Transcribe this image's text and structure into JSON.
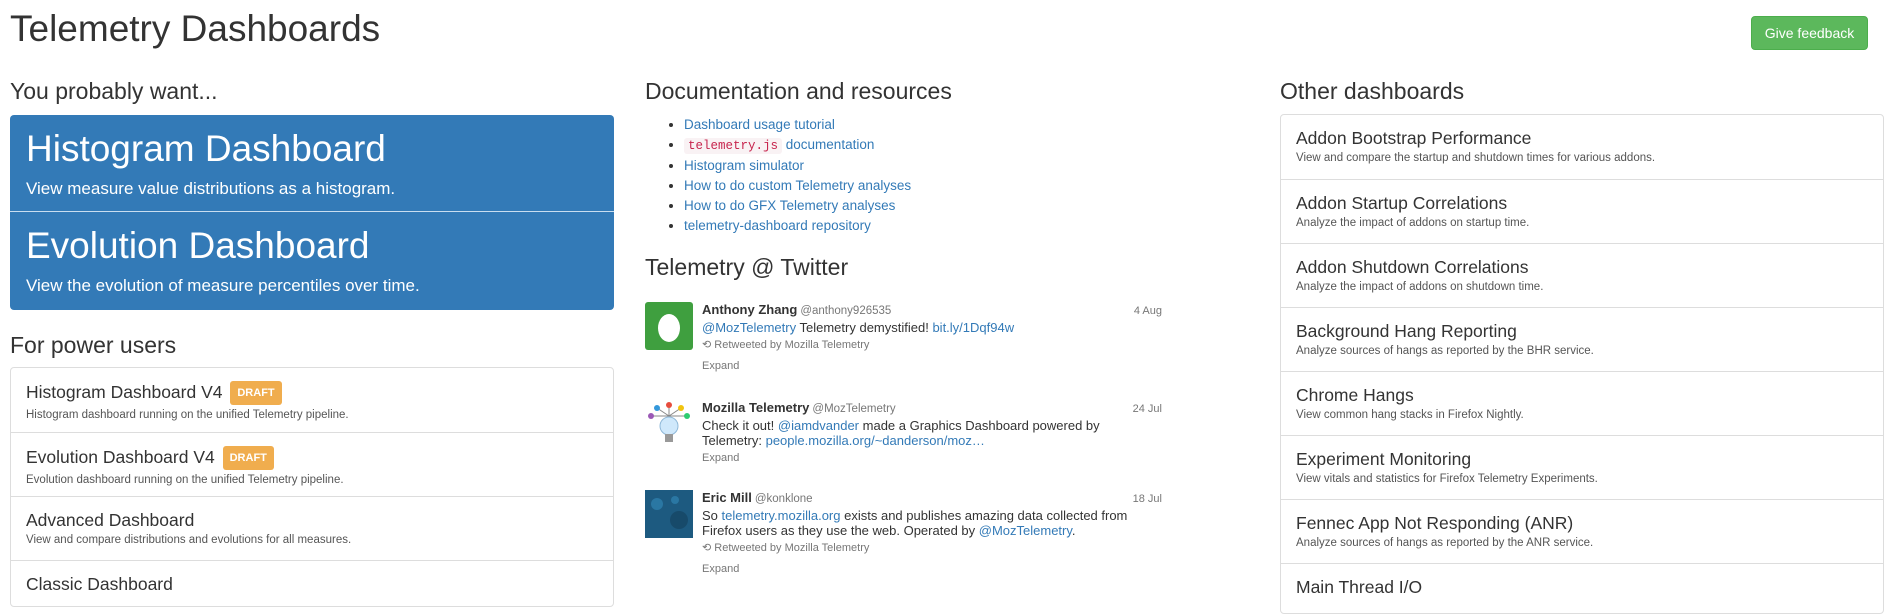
{
  "header": {
    "title": "Telemetry Dashboards",
    "feedback_label": "Give feedback"
  },
  "col1": {
    "want_title": "You probably want...",
    "primary": [
      {
        "title": "Histogram Dashboard",
        "subtitle": "View measure value distributions as a histogram."
      },
      {
        "title": "Evolution Dashboard",
        "subtitle": "View the evolution of measure percentiles over time."
      }
    ],
    "power_title": "For power users",
    "power_items": [
      {
        "title": "Histogram Dashboard V4",
        "badge": "DRAFT",
        "subtitle": "Histogram dashboard running on the unified Telemetry pipeline."
      },
      {
        "title": "Evolution Dashboard V4",
        "badge": "DRAFT",
        "subtitle": "Evolution dashboard running on the unified Telemetry pipeline."
      },
      {
        "title": "Advanced Dashboard",
        "subtitle": "View and compare distributions and evolutions for all measures."
      },
      {
        "title": "Classic Dashboard",
        "subtitle": ""
      }
    ]
  },
  "col2": {
    "docs_title": "Documentation and resources",
    "docs": [
      "Dashboard usage tutorial",
      {
        "code": "telemetry.js",
        "text": "documentation"
      },
      "Histogram simulator",
      "How to do custom Telemetry analyses",
      "How to do GFX Telemetry analyses",
      "telemetry-dashboard repository"
    ],
    "twitter_title": "Telemetry @ Twitter",
    "tweets": [
      {
        "name": "Anthony Zhang",
        "handle": "@anthony926535",
        "date": "4 Aug",
        "mention": "@MozTelemetry",
        "text": "Telemetry demystified!",
        "link": "bit.ly/1Dqf94w",
        "retweet": "Retweeted by Mozilla Telemetry",
        "expand": "Expand"
      },
      {
        "name": "Mozilla Telemetry",
        "handle": "@MozTelemetry",
        "date": "24 Jul",
        "text_before": "Check it out!",
        "mention": "@iamdvander",
        "text_after": "made a Graphics Dashboard powered by Telemetry:",
        "link": "people.mozilla.org/~danderson/moz…",
        "expand": "Expand"
      },
      {
        "name": "Eric Mill",
        "handle": "@konklone",
        "date": "18 Jul",
        "text_before": "So",
        "link": "telemetry.mozilla.org",
        "text_after": "exists and publishes amazing data collected from Firefox users as they use the web. Operated by",
        "mention": "@MozTelemetry",
        "text_end": ".",
        "retweet": "Retweeted by Mozilla Telemetry",
        "expand": "Expand"
      }
    ]
  },
  "col3": {
    "title": "Other dashboards",
    "items": [
      {
        "title": "Addon Bootstrap Performance",
        "subtitle": "View and compare the startup and shutdown times for various addons."
      },
      {
        "title": "Addon Startup Correlations",
        "subtitle": "Analyze the impact of addons on startup time."
      },
      {
        "title": "Addon Shutdown Correlations",
        "subtitle": "Analyze the impact of addons on shutdown time."
      },
      {
        "title": "Background Hang Reporting",
        "subtitle": "Analyze sources of hangs as reported by the BHR service."
      },
      {
        "title": "Chrome Hangs",
        "subtitle": "View common hang stacks in Firefox Nightly."
      },
      {
        "title": "Experiment Monitoring",
        "subtitle": "View vitals and statistics for Firefox Telemetry Experiments."
      },
      {
        "title": "Fennec App Not Responding (ANR)",
        "subtitle": "Analyze sources of hangs as reported by the ANR service."
      },
      {
        "title": "Main Thread I/O",
        "subtitle": ""
      }
    ]
  },
  "colors": {
    "primary": "#337ab7",
    "success": "#5cb85c",
    "warning": "#f0ad4e",
    "avatar1": "#3f9f3f",
    "avatar3": "#1d5a80"
  },
  "icons": [
    "egg-avatar-icon",
    "lightbulb-avatar-icon",
    "retweet-icon"
  ]
}
